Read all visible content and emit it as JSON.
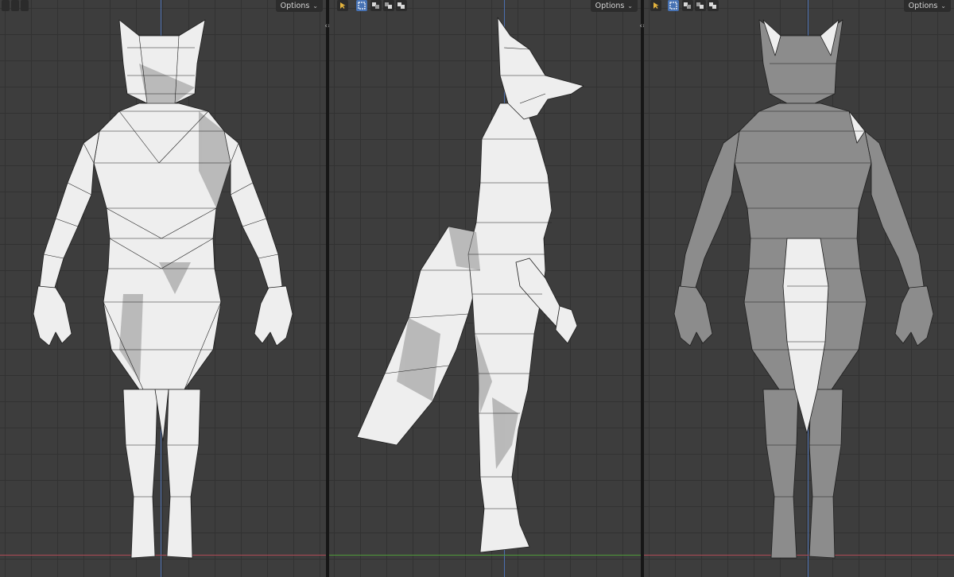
{
  "viewports": [
    {
      "view": "front",
      "options_label": "Options",
      "axis_h": "x"
    },
    {
      "view": "side",
      "options_label": "Options",
      "axis_h": "y"
    },
    {
      "view": "back",
      "options_label": "Options",
      "axis_h": "x"
    }
  ],
  "icons": {
    "select": "select-cursor-icon",
    "select_box": "select-box-icon",
    "mode_extend": "mode-extend-icon",
    "mode_subtract": "mode-subtract-icon",
    "mode_invert": "mode-invert-icon",
    "dropdown": "chevron-down-icon",
    "resize": "area-resize-icon"
  },
  "colors": {
    "grid_bg": "#3d3d3d",
    "grid_line": "#323232",
    "axis_x": "#b04a55",
    "axis_y": "#4f9a3a",
    "axis_z": "#4b6fb0",
    "active_tool": "#4772b3",
    "model_light": "#eeeeee",
    "model_shadow": "#8a8a8a"
  }
}
